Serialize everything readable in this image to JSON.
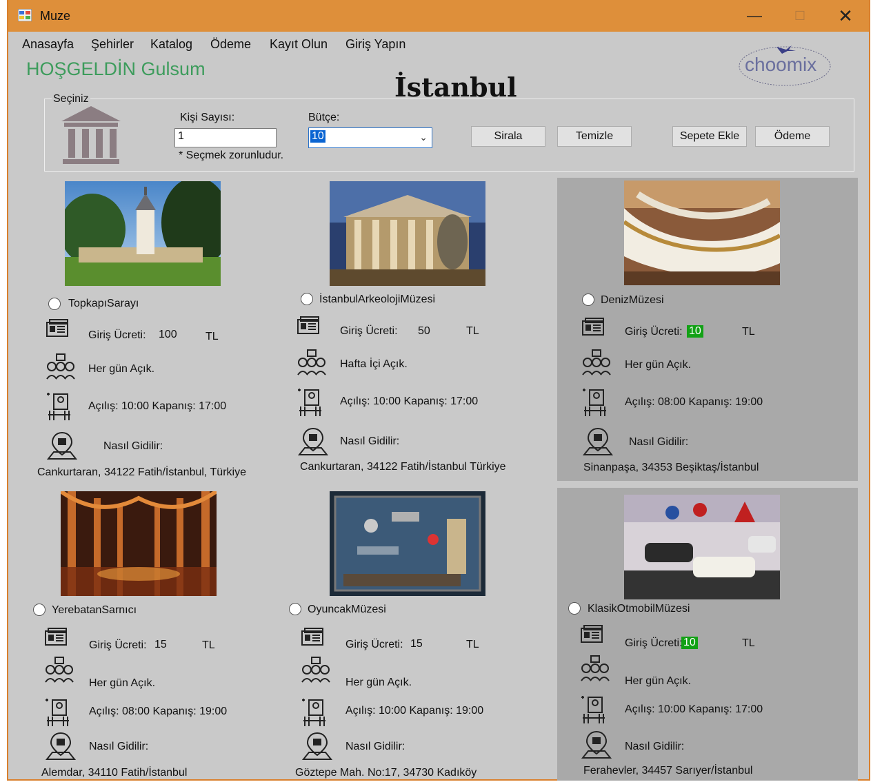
{
  "window": {
    "title": "Muze",
    "minimize": "—",
    "maximize": "☐",
    "close": "✕"
  },
  "menu": [
    "Anasayfa",
    "Şehirler",
    "Katalog",
    "Ödeme",
    "Kayıt Olun",
    "Giriş Yapın"
  ],
  "welcome": "HOŞGELDİN Gulsum",
  "city_title": "İstanbul",
  "logo_text": "choomix",
  "form": {
    "group_label": "Seçiniz",
    "people_label": "Kişi Sayısı:",
    "people_value": "1",
    "required_note": "* Seçmek zorunludur.",
    "budget_label": "Bütçe:",
    "budget_value": "10",
    "buttons": {
      "sort": "Sirala",
      "clear": "Temizle",
      "add_to_cart": "Sepete Ekle",
      "payment": "Ödeme"
    }
  },
  "labels": {
    "fee": "Giriş Ücreti:",
    "currency": "TL",
    "directions": "Nasıl Gidilir:"
  },
  "museums": [
    {
      "name": "TopkapıSarayı",
      "fee": "100",
      "fee_highlight": false,
      "days": "Her gün Açık.",
      "hours": "Açılış: 10:00 Kapanış: 17:00",
      "address": "Cankurtaran, 34122 Fatih/İstanbul, Türkiye",
      "photo": "palace-photo"
    },
    {
      "name": "İstanbulArkeolojiMüzesi",
      "fee": "50",
      "fee_highlight": false,
      "days": "Hafta İçi Açık.",
      "hours": "Açılış: 10:00 Kapanış: 17:00",
      "address": "Cankurtaran, 34122 Fatih/İstanbul Türkiye",
      "photo": "archaeology-photo"
    },
    {
      "name": "DenizMüzesi",
      "fee": "10",
      "fee_highlight": true,
      "days": "Her gün Açık.",
      "hours": "Açılış: 08:00 Kapanış: 19:00",
      "address": "Sinanpaşa, 34353 Beşiktaş/İstanbul",
      "photo": "naval-photo"
    },
    {
      "name": "YerebatanSarnıcı",
      "fee": "15",
      "fee_highlight": false,
      "days": "Her gün Açık.",
      "hours": "Açılış: 08:00 Kapanış: 19:00",
      "address": "Alemdar, 34110 Fatih/İstanbul",
      "photo": "cistern-photo"
    },
    {
      "name": "OyuncakMüzesi",
      "fee": "15",
      "fee_highlight": false,
      "days": "Her gün Açık.",
      "hours": "Açılış: 10:00 Kapanış: 19:00",
      "address": "Göztepe Mah. No:17, 34730 Kadıköy",
      "photo": "toy-photo"
    },
    {
      "name": "KlasikOtmobilMüzesi",
      "fee": "10",
      "fee_highlight": true,
      "days": "Her gün Açık.",
      "hours": "Açılış: 10:00 Kapanış: 17:00",
      "address": "Ferahevler, 34457 Sarıyer/İstanbul",
      "photo": "car-photo"
    }
  ],
  "colors": {
    "titlebar": "#de8f3a",
    "window_bg": "#c9c9c9",
    "gray_panel": "#a9a9a9",
    "welcome_green": "#3d9c5c",
    "fee_highlight": "#12a115"
  }
}
